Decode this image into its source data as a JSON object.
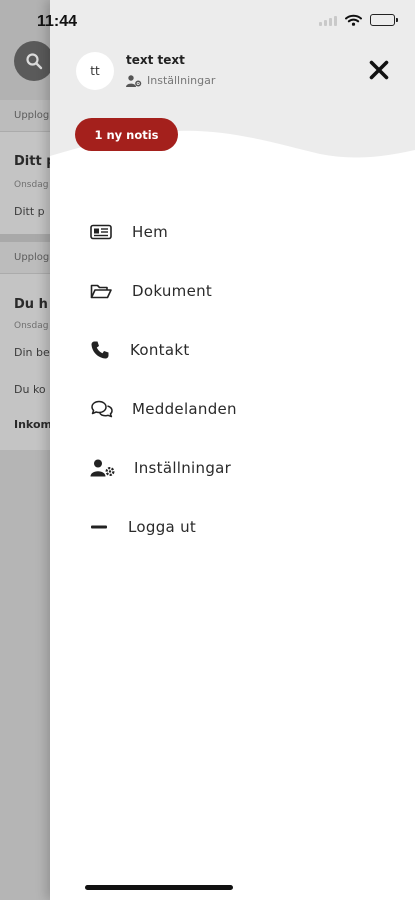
{
  "status_bar": {
    "time": "11:44"
  },
  "background": {
    "section_label_1": "Upplog",
    "item_1_title": "Ditt p",
    "item_1_meta": "Onsdag",
    "item_1_body": "Ditt p",
    "section_label_2": "Upplog",
    "item_2_title": "Du h",
    "item_2_meta": "Onsdag",
    "item_2_body_1": "Din be",
    "item_2_body_2": "Du ko",
    "item_2_bold": "Inkom"
  },
  "drawer": {
    "avatar_initials": "tt",
    "user_name": "text text",
    "settings_link": "Inställningar",
    "notification_badge": "1 ny notis",
    "accent_color": "#a4201c",
    "menu": [
      {
        "label": "Hem",
        "icon": "id-card-icon"
      },
      {
        "label": "Dokument",
        "icon": "folder-open-icon"
      },
      {
        "label": "Kontakt",
        "icon": "phone-icon"
      },
      {
        "label": "Meddelanden",
        "icon": "chat-bubbles-icon"
      },
      {
        "label": "Inställningar",
        "icon": "user-gear-icon"
      },
      {
        "label": "Logga ut",
        "icon": "minus-icon"
      }
    ]
  }
}
